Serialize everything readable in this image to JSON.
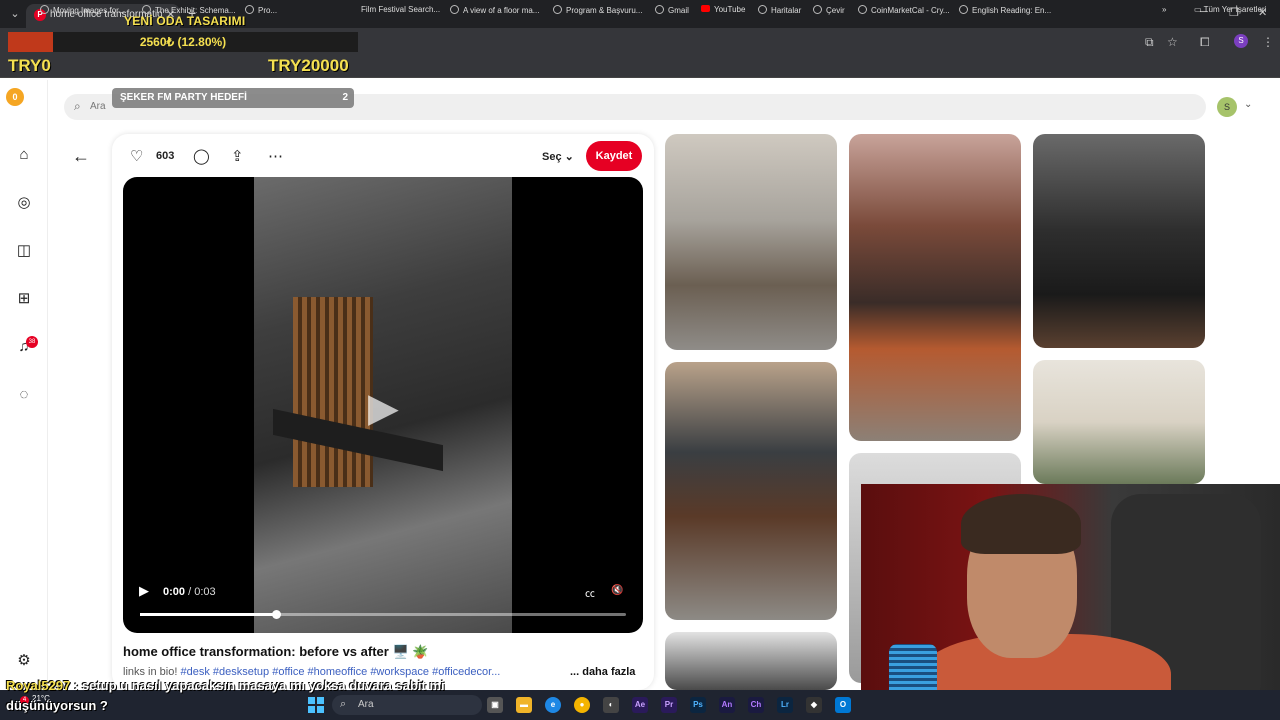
{
  "browser": {
    "tab_title": "home office transformation: before vs after",
    "overlay_title": "YENİ ODA TASARIMI",
    "donation_progress": "2560₺ (12.80%)",
    "donation_fraction": 0.128,
    "try_left": "TRY0",
    "try_right": "TRY20000",
    "bookmarks": [
      "Moving Images for...",
      "The Exhibit: Schema...",
      "Pro...",
      "Film Festival Search...",
      "A view of a floor ma...",
      "Program & Başvuru...",
      "Gmail",
      "YouTube",
      "Haritalar",
      "Çevir",
      "CoinMarketCal - Cry...",
      "English Reading: En..."
    ],
    "all_bookmarks": "Tüm Yer İşaretleri",
    "profile_initial": "S"
  },
  "pinterest": {
    "search_placeholder": "Ara",
    "party_label": "ŞEKER FM PARTY HEDEFİ",
    "party_count": "2",
    "notif_count": "38",
    "logo_badge": "0",
    "avatar_initial": "S",
    "likes": "603",
    "select_label": "Seç",
    "save_label": "Kaydet",
    "time_current": "0:00",
    "time_sep": " / ",
    "time_total": "0:03",
    "progress_fraction": 0.28,
    "title": "home office transformation: before vs after 🖥️ 🪴",
    "tags_prefix": "links in bio! ",
    "tags": [
      "#desk",
      "#desksetup",
      "#office",
      "#homeoffice",
      "#workspace",
      "#officedecor..."
    ],
    "more_label": "... daha fazla"
  },
  "chat": {
    "user": "Royal5297",
    "message": " : setup u nasıl yapacaksın masaya mı yoksa duvara sabit mi düşünüyorsun ?"
  },
  "taskbar": {
    "search_placeholder": "Ara",
    "weather": "21°C",
    "notif_count": "4",
    "apps": [
      "Ae",
      "Pr",
      "Ps",
      "An",
      "Ch",
      "Lr"
    ]
  },
  "colors": {
    "accent": "#e60023",
    "overlay_yellow": "#f5e050",
    "progress_red": "#c0391b"
  }
}
